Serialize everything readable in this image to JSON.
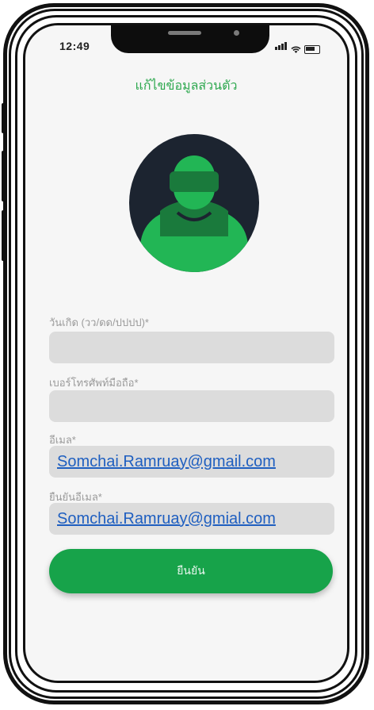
{
  "status_bar": {
    "time": "12:49"
  },
  "page": {
    "title": "แก้ไขข้อมูลส่วนตัว"
  },
  "form": {
    "birthdate": {
      "label": "วันเกิด (วว/ดด/ปปปป)*",
      "value": ""
    },
    "phone": {
      "label": "เบอร์โทรศัพท์มือถือ*",
      "value": ""
    },
    "email": {
      "label": "อีเมล*",
      "value": "Somchai.Ramruay@gmail.com"
    },
    "email_confirm": {
      "label": "ยืนยันอีเมล*",
      "value": "Somchai.Ramruay@gmial.com"
    }
  },
  "confirm_button": {
    "label": "ยืนยัน"
  },
  "colors": {
    "accent": "#17a34a",
    "title_green": "#2ea84f",
    "avatar_bg": "#1c2430"
  },
  "icons": [
    "user-avatar-icon",
    "signal-icon",
    "wifi-icon",
    "battery-icon"
  ]
}
